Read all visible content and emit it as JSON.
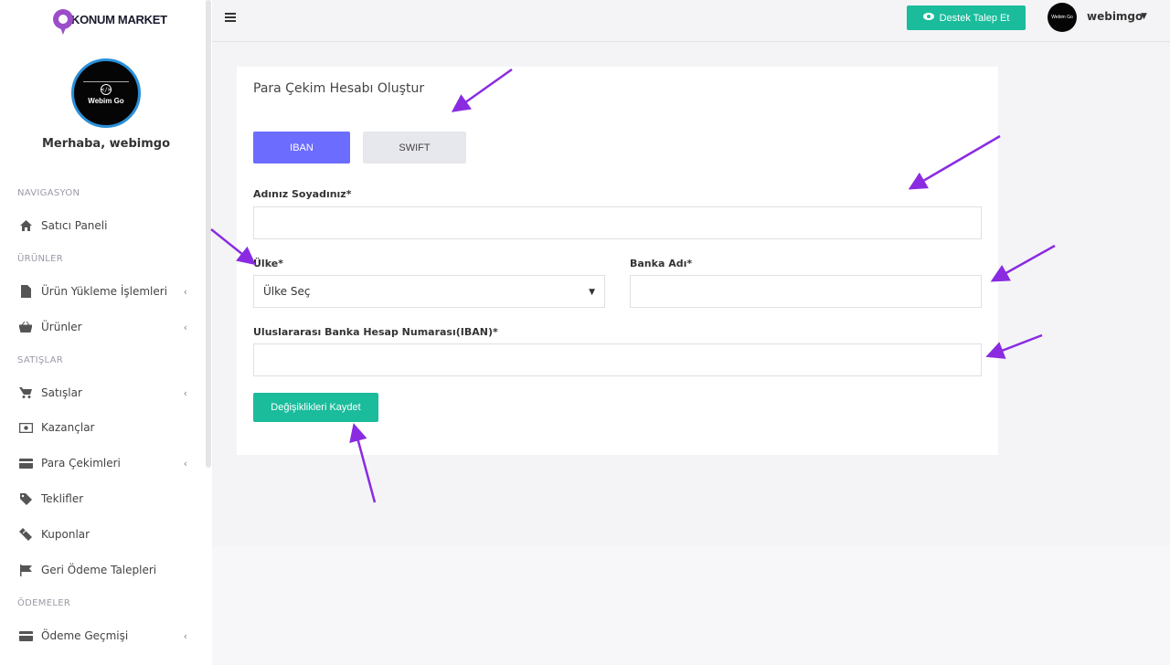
{
  "brand": {
    "logo_text": "KONUM MARKET",
    "avatar_text": "Webim Go"
  },
  "sidebar": {
    "greeting": "Merhaba, webimgo",
    "sections": [
      {
        "label": "NAVIGASYON"
      },
      {
        "label": "ÜRÜNLER"
      },
      {
        "label": "SATIŞLAR"
      },
      {
        "label": "ÖDEMELER"
      }
    ],
    "items": [
      {
        "label": "Satıcı Paneli",
        "icon": "home-icon",
        "has_submenu": false
      },
      {
        "label": "Ürün Yükleme İşlemleri",
        "icon": "file-icon",
        "has_submenu": true
      },
      {
        "label": "Ürünler",
        "icon": "basket-icon",
        "has_submenu": true
      },
      {
        "label": "Satışlar",
        "icon": "cart-icon",
        "has_submenu": true
      },
      {
        "label": "Kazançlar",
        "icon": "money-icon",
        "has_submenu": false
      },
      {
        "label": "Para Çekimleri",
        "icon": "credit-card-icon",
        "has_submenu": true
      },
      {
        "label": "Teklifler",
        "icon": "tag-icon",
        "has_submenu": false
      },
      {
        "label": "Kuponlar",
        "icon": "ticket-icon",
        "has_submenu": false
      },
      {
        "label": "Geri Ödeme Talepleri",
        "icon": "flag-icon",
        "has_submenu": false
      },
      {
        "label": "Ödeme Geçmişi",
        "icon": "credit-card-icon",
        "has_submenu": true
      }
    ]
  },
  "topbar": {
    "support_label": "Destek Talep Et",
    "user_name": "webimgo"
  },
  "form": {
    "title": "Para Çekim Hesabı Oluştur",
    "tabs": [
      {
        "label": "IBAN",
        "active": true
      },
      {
        "label": "SWIFT",
        "active": false
      }
    ],
    "full_name_label": "Adınız Soyadınız*",
    "full_name_value": "",
    "country_label": "Ülke*",
    "country_value": "Ülke Seç",
    "bank_name_label": "Banka Adı*",
    "bank_name_value": "",
    "iban_label": "Uluslararası Banka Hesap Numarası(IBAN)*",
    "iban_value": "",
    "save_label": "Değişiklikleri Kaydet"
  },
  "colors": {
    "accent_green": "#1abc9c",
    "tab_active": "#6c6cff",
    "annotation_arrow": "#8a2be2"
  }
}
